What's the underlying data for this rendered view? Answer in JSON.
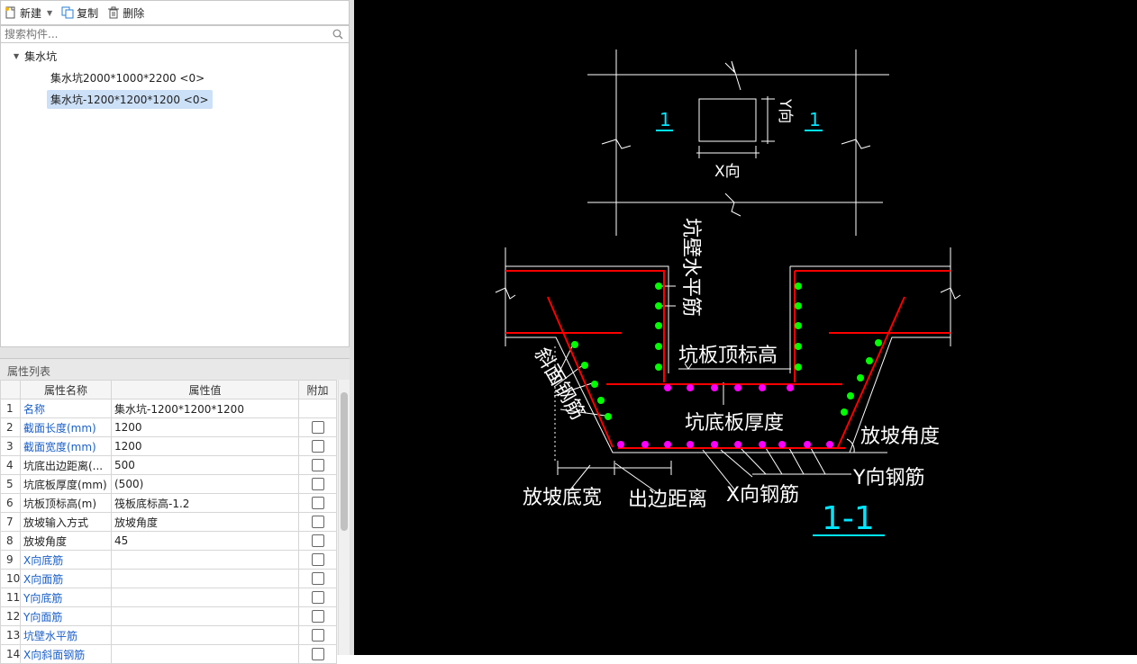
{
  "toolbar": {
    "new_label": "新建",
    "copy_label": "复制",
    "delete_label": "删除"
  },
  "search": {
    "placeholder": "搜索构件..."
  },
  "tree": {
    "root_label": "集水坑",
    "items": [
      {
        "label": "集水坑2000*1000*2200 <0>",
        "selected": false
      },
      {
        "label": "集水坑-1200*1200*1200 <0>",
        "selected": true
      }
    ]
  },
  "props": {
    "panel_title": "属性列表",
    "headers": [
      "属性名称",
      "属性值",
      "附加"
    ],
    "rows": [
      {
        "idx": "1",
        "name": "名称",
        "value": "集水坑-1200*1200*1200",
        "blue": true,
        "checkbox": false
      },
      {
        "idx": "2",
        "name": "截面长度(mm)",
        "value": "1200",
        "blue": true,
        "checkbox": true
      },
      {
        "idx": "3",
        "name": "截面宽度(mm)",
        "value": "1200",
        "blue": true,
        "checkbox": true
      },
      {
        "idx": "4",
        "name": "坑底出边距离(...",
        "value": "500",
        "blue": false,
        "checkbox": true
      },
      {
        "idx": "5",
        "name": "坑底板厚度(mm)",
        "value": "(500)",
        "blue": false,
        "checkbox": true
      },
      {
        "idx": "6",
        "name": "坑板顶标高(m)",
        "value": "筏板底标高-1.2",
        "blue": false,
        "checkbox": true
      },
      {
        "idx": "7",
        "name": "放坡输入方式",
        "value": "放坡角度",
        "blue": false,
        "checkbox": true
      },
      {
        "idx": "8",
        "name": "放坡角度",
        "value": "45",
        "blue": false,
        "checkbox": true
      },
      {
        "idx": "9",
        "name": "X向底筋",
        "value": "",
        "blue": true,
        "checkbox": true
      },
      {
        "idx": "10",
        "name": "X向面筋",
        "value": "",
        "blue": true,
        "checkbox": true
      },
      {
        "idx": "11",
        "name": "Y向底筋",
        "value": "",
        "blue": true,
        "checkbox": true
      },
      {
        "idx": "12",
        "name": "Y向面筋",
        "value": "",
        "blue": true,
        "checkbox": true
      },
      {
        "idx": "13",
        "name": "坑壁水平筋",
        "value": "",
        "blue": true,
        "checkbox": true
      },
      {
        "idx": "14",
        "name": "X向斜面钢筋",
        "value": "",
        "blue": true,
        "checkbox": true
      }
    ]
  },
  "drawing": {
    "plan_section_left": "1",
    "plan_section_right": "1",
    "plan_x_label": "X向",
    "plan_y_label": "Y向",
    "wall_rebar_label": "坑壁水平筋",
    "top_elev_label": "坑板顶标高",
    "slope_rebar_label": "斜面钢筋",
    "slab_thickness_label": "坑底板厚度",
    "slope_angle_label": "放坡角度",
    "y_rebar_label": "Y向钢筋",
    "slope_width_label": "放坡底宽",
    "edge_dist_label": "出边距离",
    "x_rebar_label": "X向钢筋",
    "section_title": "1-1",
    "colors": {
      "background": "#000000",
      "lines": "#ffffff",
      "rebar": "#ff0000",
      "wall_dots": "#00ff00",
      "slab_dots": "#ff00ff",
      "section_marks": "#00e5ff"
    }
  }
}
